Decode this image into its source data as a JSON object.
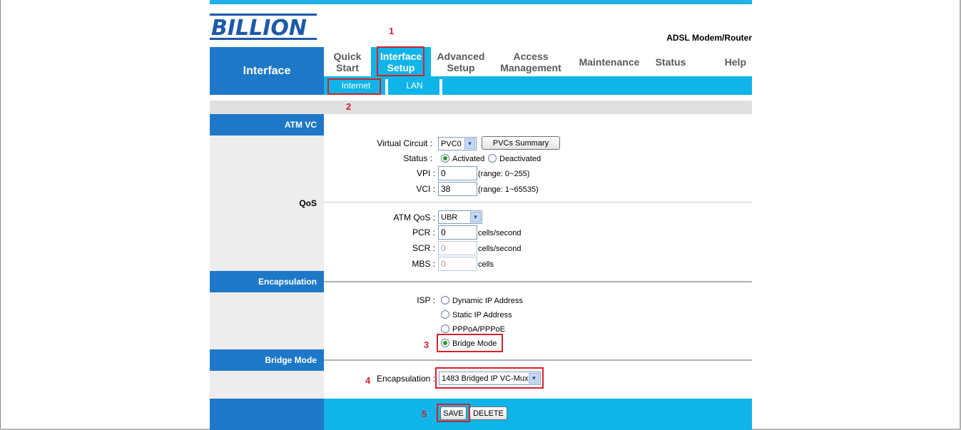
{
  "brand": {
    "logo_text": "BILLION",
    "product": "ADSL Modem/Router"
  },
  "sidebar_title": "Interface",
  "nav": {
    "items": [
      {
        "label": "Quick\nStart"
      },
      {
        "label": "Interface\nSetup",
        "active": true
      },
      {
        "label": "Advanced\nSetup"
      },
      {
        "label": "Access\nManagement"
      },
      {
        "label": "Maintenance"
      },
      {
        "label": "Status"
      },
      {
        "label": "Help"
      }
    ],
    "sub_items": [
      {
        "label": "Internet",
        "active": true
      },
      {
        "label": "LAN"
      }
    ]
  },
  "sections": {
    "atm_vc": "ATM VC",
    "qos": "QoS",
    "encapsulation": "Encapsulation",
    "bridge_mode": "Bridge Mode"
  },
  "atm": {
    "virtual_circuit_label": "Virtual Circuit :",
    "virtual_circuit_value": "PVC0",
    "pvcs_summary_button": "PVCs Summary",
    "status_label": "Status :",
    "status_options": [
      "Activated",
      "Deactivated"
    ],
    "status_selected": "Activated",
    "vpi_label": "VPI :",
    "vpi_value": "0",
    "vpi_range": "(range: 0~255)",
    "vci_label": "VCI :",
    "vci_value": "38",
    "vci_range": "(range: 1~65535)"
  },
  "qos": {
    "atm_qos_label": "ATM QoS :",
    "atm_qos_value": "UBR",
    "pcr_label": "PCR :",
    "pcr_value": "0",
    "pcr_unit": "cells/second",
    "scr_label": "SCR :",
    "scr_value": "0",
    "scr_unit": "cells/second",
    "mbs_label": "MBS :",
    "mbs_value": "0",
    "mbs_unit": "cells"
  },
  "isp": {
    "label": "ISP :",
    "options": [
      "Dynamic IP Address",
      "Static IP Address",
      "PPPoA/PPPoE",
      "Bridge Mode"
    ],
    "selected": "Bridge Mode"
  },
  "bridge": {
    "encapsulation_label": "Encapsulation :",
    "encapsulation_value": "1483 Bridged IP VC-Mux"
  },
  "buttons": {
    "save": "SAVE",
    "delete": "DELETE"
  },
  "annotations": {
    "step1": "1",
    "step2": "2",
    "step3": "3",
    "step4": "4",
    "step5": "5"
  },
  "colors": {
    "accent_blue": "#1e78c8",
    "cyan": "#0fb4e8",
    "annotation_red": "#d8202a"
  }
}
